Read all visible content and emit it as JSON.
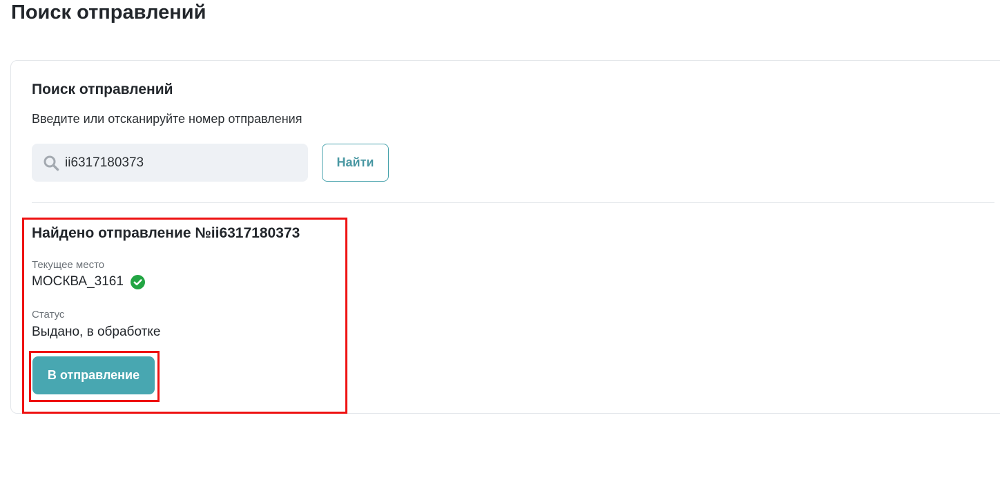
{
  "page": {
    "title": "Поиск отправлений"
  },
  "search_card": {
    "title": "Поиск отправлений",
    "subtitle": "Введите или отсканируйте номер отправления",
    "search_value": "ii6317180373",
    "search_icon": "search-icon",
    "find_label": "Найти"
  },
  "result": {
    "title": "Найдено отправление №ii6317180373",
    "location_label": "Текущее место",
    "location_value": "МОСКВА_3161",
    "location_status_icon": "check-circle-icon",
    "status_label": "Статус",
    "status_value": "Выдано, в обработке",
    "action_label": "В отправление"
  },
  "colors": {
    "accent": "#48a7b1",
    "success": "#22a543",
    "highlight": "#ee1111",
    "input_bg": "#eef1f5"
  }
}
